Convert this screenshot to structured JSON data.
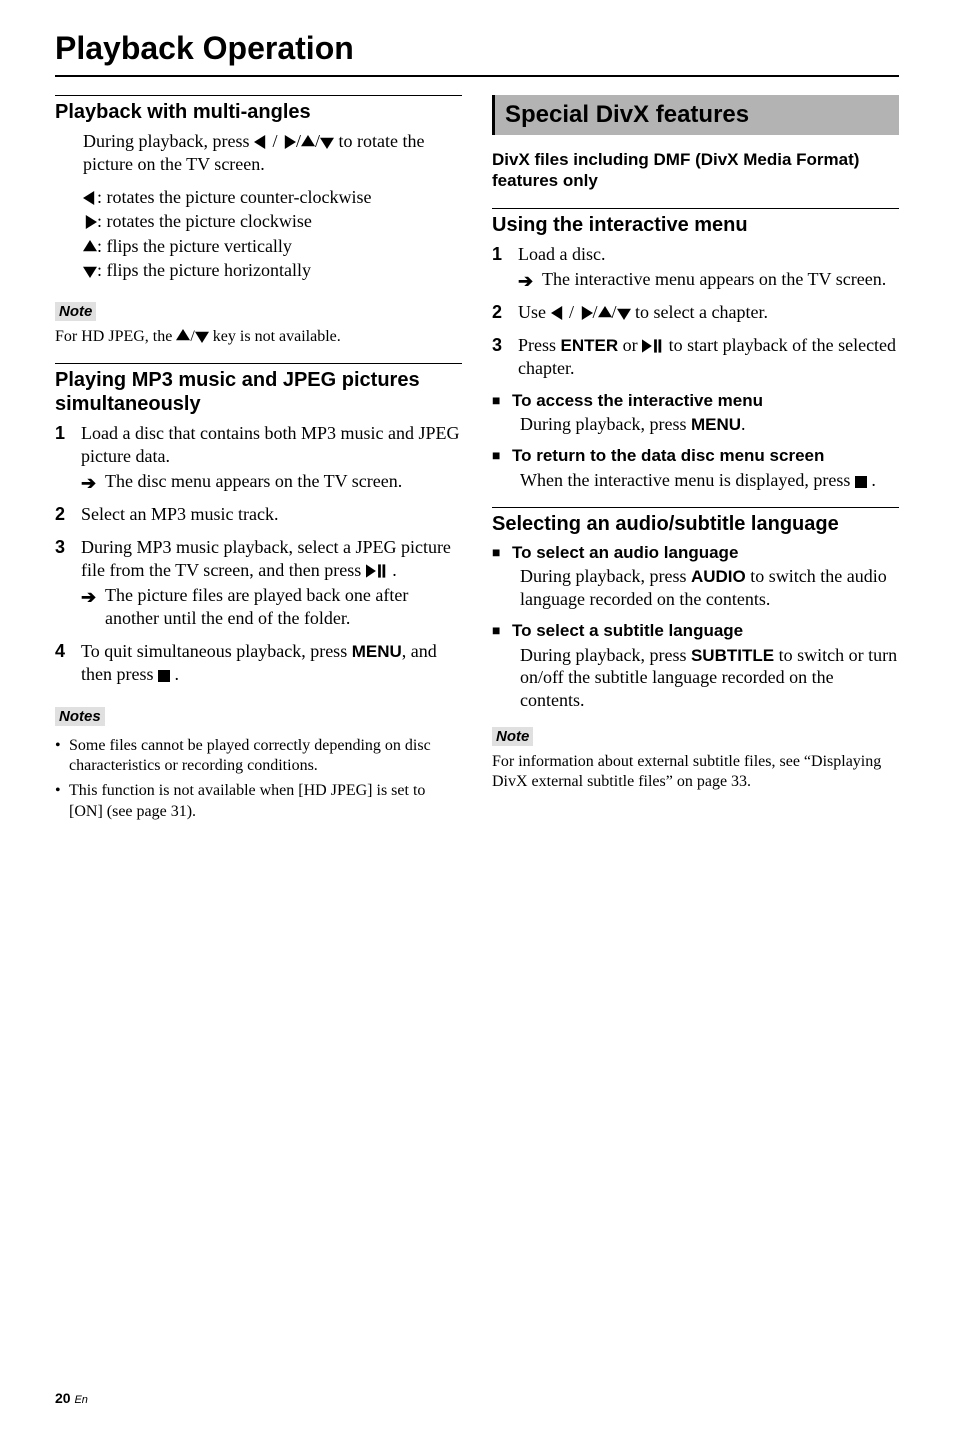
{
  "chapter_title": "Playback Operation",
  "left": {
    "multi_heading": "Playback with multi-angles",
    "multi_intro_a": "During playback, press ",
    "multi_intro_b": " to rotate the picture on the TV screen.",
    "bullets": [
      {
        "icon": "tri-left",
        "text": ": rotates the picture counter-clockwise"
      },
      {
        "icon": "tri-right",
        "text": ": rotates the picture clockwise"
      },
      {
        "icon": "tri-up",
        "text": ": flips the picture vertically"
      },
      {
        "icon": "tri-down",
        "text": ": flips the picture horizontally"
      }
    ],
    "note_label": "Note",
    "note_hdjpeg_a": "For HD JPEG, the ",
    "note_hdjpeg_b": " key is not available.",
    "mp3_heading": "Playing MP3 music and JPEG pictures simultaneously",
    "steps": [
      {
        "n": "1",
        "text": "Load a disc that contains both MP3 music and JPEG picture data.",
        "sub": "The disc menu appears on the TV screen."
      },
      {
        "n": "2",
        "text": "Select an MP3 music track."
      },
      {
        "n": "3",
        "text_a": "During MP3 music playback, select a JPEG picture file from the TV screen, and then press ",
        "text_b": " .",
        "sub": "The picture files are played back one after another until the end of the folder."
      },
      {
        "n": "4",
        "text_a": "To quit simultaneous playback, press ",
        "menu": "MENU",
        "text_b": ", and then press ",
        "text_c": " ."
      }
    ],
    "notes_label": "Notes",
    "notes": [
      "Some files cannot be played correctly depending on disc characteristics or recording conditions.",
      "This function is not available when [HD JPEG] is set to [ON] (see page 31)."
    ]
  },
  "right": {
    "banner": "Special DivX features",
    "sub_bold": "DivX files including DMF (DivX Media Format) features only",
    "int_heading": "Using the interactive menu",
    "int_steps": [
      {
        "n": "1",
        "text": "Load a disc.",
        "sub": "The interactive menu appears on the TV screen."
      },
      {
        "n": "2",
        "text_a": "Use ",
        "text_b": " to select a chapter."
      },
      {
        "n": "3",
        "text_a": "Press ",
        "enter": "ENTER",
        "text_b": " or ",
        "text_c": " to start playback of the selected chapter."
      }
    ],
    "sq1_title": "To access the interactive menu",
    "sq1_body_a": "During playback, press ",
    "sq1_menu": "MENU",
    "sq1_body_b": ".",
    "sq2_title": "To return to the data disc menu screen",
    "sq2_body_a": "When the interactive menu is displayed, press ",
    "sq2_body_b": " .",
    "sel_heading": "Selecting an audio/subtitle language",
    "sq3_title": "To select an audio language",
    "sq3_body_a": "During playback, press ",
    "sq3_audio": "AUDIO",
    "sq3_body_b": " to switch the audio language recorded on the contents.",
    "sq4_title": "To select a subtitle language",
    "sq4_body_a": "During playback, press ",
    "sq4_sub": "SUBTITLE",
    "sq4_body_b": " to switch or turn on/off the subtitle language recorded on the contents.",
    "note_label": "Note",
    "note_ext": "For information about external subtitle files, see “Displaying DivX external subtitle files” on page 33."
  },
  "page_num": "20",
  "page_lang": "En"
}
